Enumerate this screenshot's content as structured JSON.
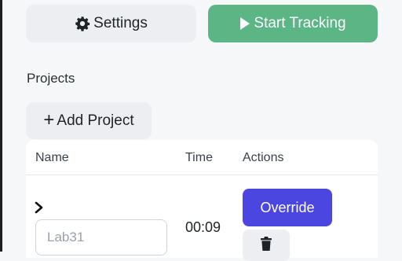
{
  "toolbar": {
    "settings_label": "Settings",
    "settings_icon": "gear-icon",
    "start_label": "Start Tracking",
    "start_icon": "play-icon",
    "start_color": "#5cb585"
  },
  "projects": {
    "title": "Projects",
    "add_label": "Add Project",
    "add_icon": "plus-icon",
    "columns": [
      "Name",
      "Time",
      "Actions"
    ],
    "rows": [
      {
        "name_value": "",
        "name_placeholder": "Lab31",
        "time": "00:09",
        "override_label": "Override",
        "override_color": "#4b46df",
        "delete_icon": "trash-icon"
      }
    ]
  }
}
